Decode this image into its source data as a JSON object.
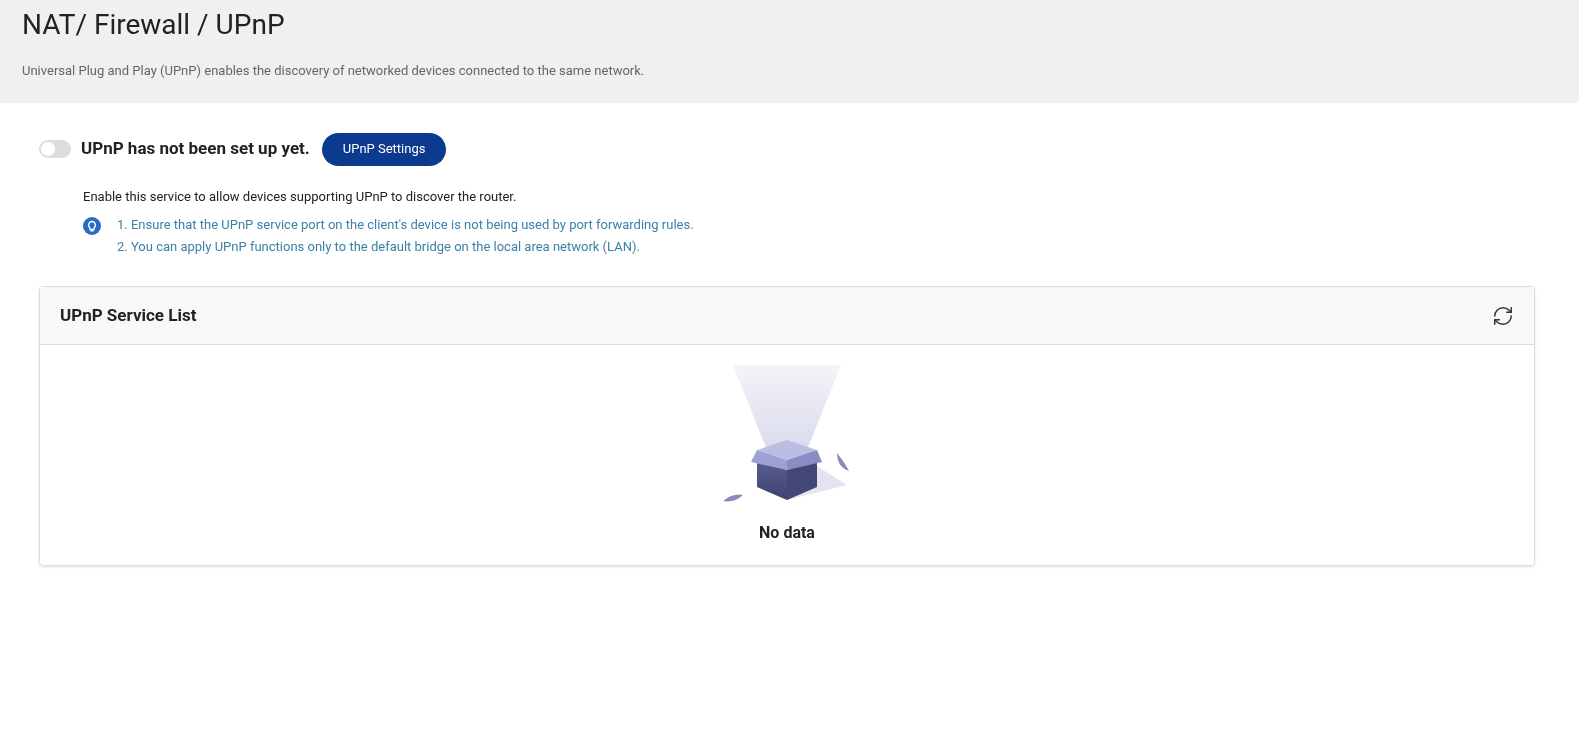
{
  "header": {
    "title": "NAT/ Firewall / UPnP",
    "description": "Universal Plug and Play (UPnP) enables the discovery of networked devices connected to the same network."
  },
  "upnp": {
    "on": false,
    "status": "UPnP has not been set up yet.",
    "settings_button": "UPnP Settings",
    "description": "Enable this service to allow devices supporting UPnP to discover the router.",
    "notes": [
      "1. Ensure that the UPnP service port on the client's device is not being used by port forwarding rules.",
      "2. You can apply UPnP functions only to the default bridge on the local area network (LAN)."
    ]
  },
  "service_list": {
    "title": "UPnP Service List",
    "empty_text": "No data"
  }
}
